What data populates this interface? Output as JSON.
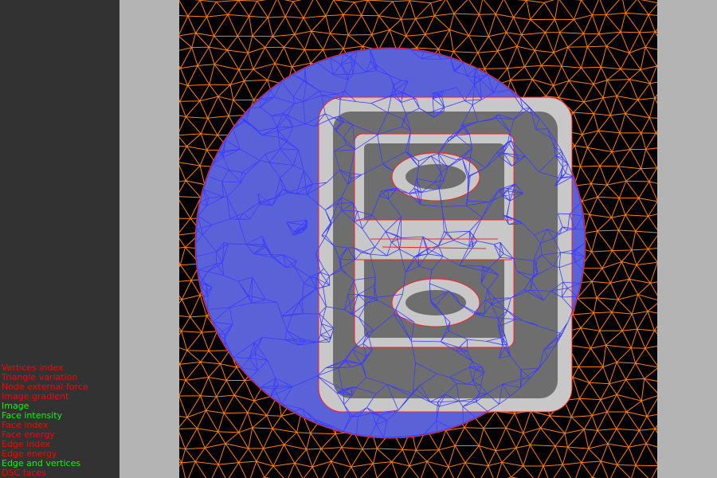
{
  "colors": {
    "panel_bg": "#323232",
    "page_bg": "#b4b4b4",
    "canvas_bg": "#000000",
    "option_on": "#00ff00",
    "option_off": "#ff0000",
    "outer_mesh": "#ff7f00",
    "inner_mesh": "#3c3cff",
    "interface_edge": "#ff2020",
    "shape_fill": "#6e6e6e",
    "disk_fill": "#5a62d8",
    "ring_fill": "#c8c8c8"
  },
  "options": [
    {
      "label": "Vertices index",
      "on": false
    },
    {
      "label": "Triangle variation",
      "on": false
    },
    {
      "label": "Node external force",
      "on": false
    },
    {
      "label": "Image gradient",
      "on": false
    },
    {
      "label": "Image",
      "on": true
    },
    {
      "label": "Face intensity",
      "on": true
    },
    {
      "label": "Face index",
      "on": false
    },
    {
      "label": "Face energy",
      "on": false
    },
    {
      "label": "Edge index",
      "on": false
    },
    {
      "label": "Edge energy",
      "on": false
    },
    {
      "label": "Edge and vertices",
      "on": true
    },
    {
      "label": "DSC faces",
      "on": false
    }
  ]
}
